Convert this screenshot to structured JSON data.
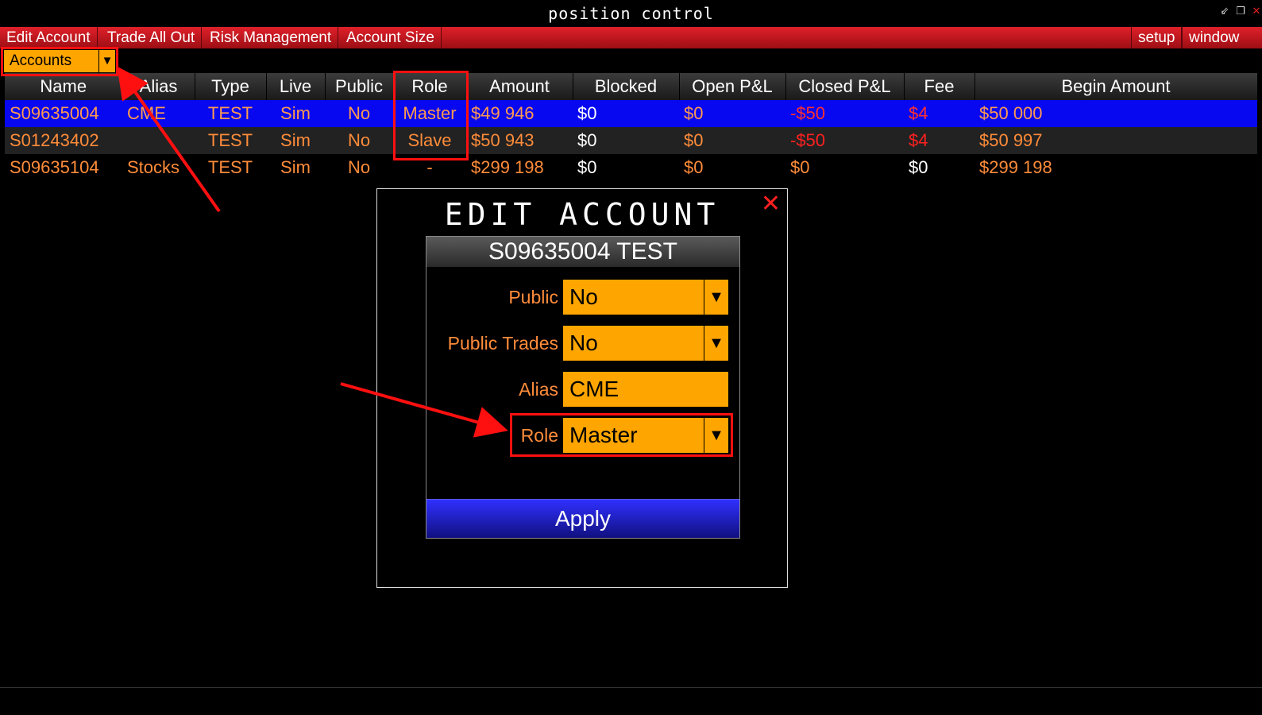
{
  "window": {
    "title": "position control"
  },
  "menu": {
    "left": [
      "Edit Account",
      "Trade All Out",
      "Risk Management",
      "Account Size"
    ],
    "right": [
      "setup",
      "window"
    ]
  },
  "accounts_dropdown": {
    "value": "Accounts"
  },
  "table": {
    "columns": [
      "Name",
      "Alias",
      "Type",
      "Live",
      "Public",
      "Role",
      "Amount",
      "Blocked",
      "Open P&L",
      "Closed P&L",
      "Fee",
      "Begin Amount"
    ],
    "rows": [
      [
        "S09635004",
        "CME",
        "TEST",
        "Sim",
        "No",
        "Master",
        "$49 946",
        "$0",
        "$0",
        "-$50",
        "$4",
        "$50 000"
      ],
      [
        "S01243402",
        "",
        "TEST",
        "Sim",
        "No",
        "Slave",
        "$50 943",
        "$0",
        "$0",
        "-$50",
        "$4",
        "$50 997"
      ],
      [
        "S09635104",
        "Stocks",
        "TEST",
        "Sim",
        "No",
        "-",
        "$299 198",
        "$0",
        "$0",
        "$0",
        "$0",
        "$299 198"
      ]
    ]
  },
  "dialog": {
    "title": "EDIT ACCOUNT",
    "account": "S09635004 TEST",
    "fields": {
      "public": {
        "label": "Public",
        "value": "No"
      },
      "public_trades": {
        "label": "Public Trades",
        "value": "No"
      },
      "alias": {
        "label": "Alias",
        "value": "CME"
      },
      "role": {
        "label": "Role",
        "value": "Master"
      }
    },
    "apply_label": "Apply"
  },
  "colors": {
    "accent_orange": "#ffa500",
    "menu_red": "#c8141c",
    "selected_row": "#0808f0",
    "annotation_red": "#ff1010"
  },
  "icons": {
    "minimize": "minimize-icon",
    "restore": "restore-icon",
    "close": "close-icon",
    "dropdown": "triangle-down-icon"
  }
}
